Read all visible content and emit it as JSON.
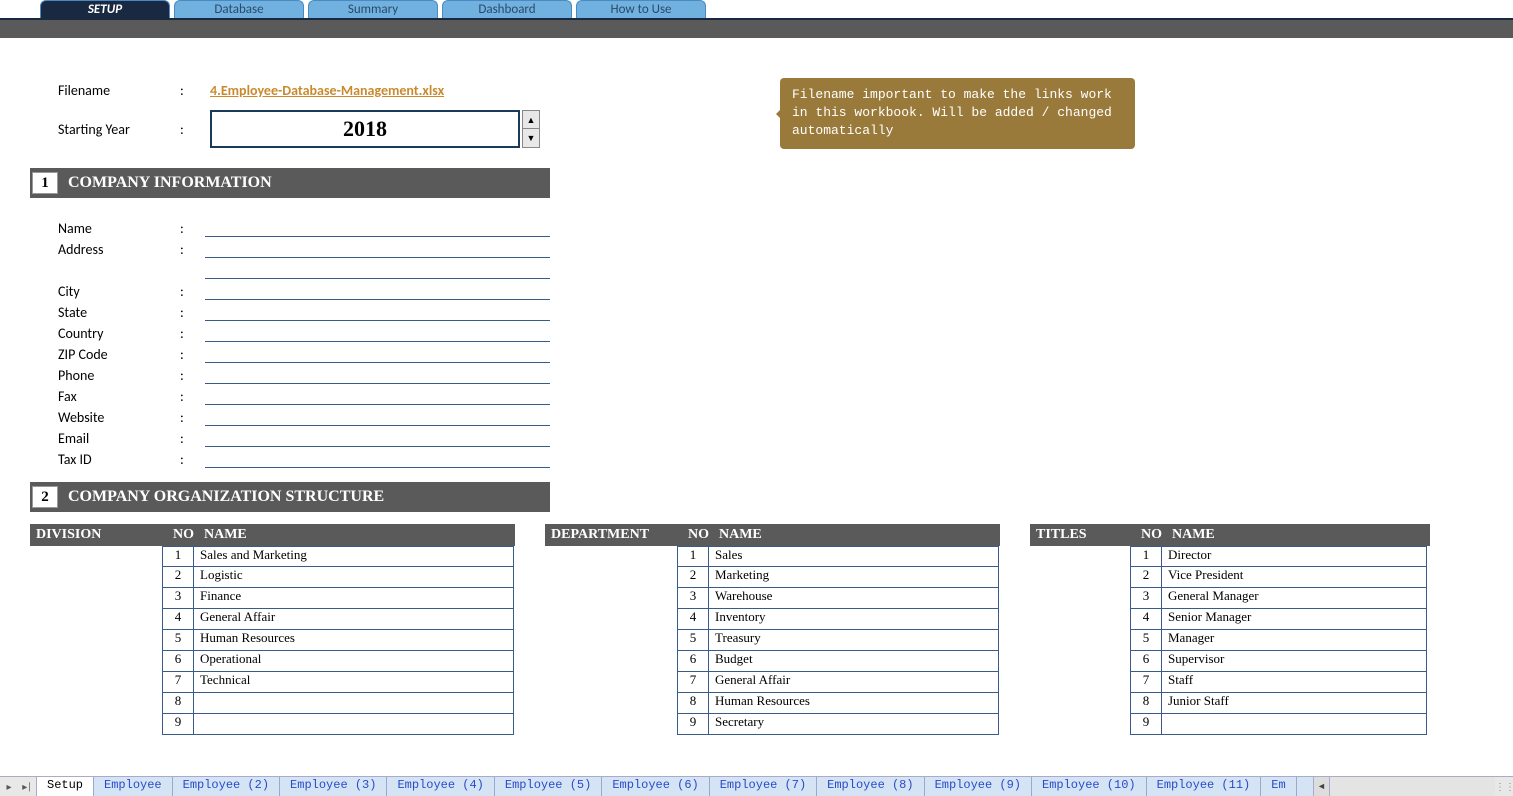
{
  "topTabs": [
    {
      "label": "SETUP",
      "active": true
    },
    {
      "label": "Database",
      "active": false
    },
    {
      "label": "Summary",
      "active": false
    },
    {
      "label": "Dashboard",
      "active": false
    },
    {
      "label": "How to Use",
      "active": false
    }
  ],
  "header": {
    "filenameLabel": "Filename",
    "filenameValue": "4.Employee-Database-Management.xlsx",
    "startingYearLabel": "Starting Year",
    "startingYearValue": "2018",
    "colon": ":"
  },
  "tooltip": "Filename important to make the links work in this workbook. Will be added / changed automatically",
  "section1": {
    "num": "1",
    "title": "COMPANY INFORMATION"
  },
  "section2": {
    "num": "2",
    "title": "COMPANY ORGANIZATION STRUCTURE"
  },
  "companyFields": [
    "Name",
    "Address",
    "",
    "City",
    "State",
    "Country",
    "ZIP Code",
    "Phone",
    "Fax",
    "Website",
    "Email",
    "Tax ID"
  ],
  "tableHeaders": {
    "no": "NO",
    "name": "NAME"
  },
  "division": {
    "title": "DIVISION",
    "rows": [
      {
        "no": "1",
        "name": "Sales and Marketing"
      },
      {
        "no": "2",
        "name": "Logistic"
      },
      {
        "no": "3",
        "name": "Finance"
      },
      {
        "no": "4",
        "name": "General Affair"
      },
      {
        "no": "5",
        "name": "Human Resources"
      },
      {
        "no": "6",
        "name": "Operational"
      },
      {
        "no": "7",
        "name": "Technical"
      },
      {
        "no": "8",
        "name": ""
      },
      {
        "no": "9",
        "name": ""
      }
    ]
  },
  "department": {
    "title": "DEPARTMENT",
    "rows": [
      {
        "no": "1",
        "name": "Sales"
      },
      {
        "no": "2",
        "name": "Marketing"
      },
      {
        "no": "3",
        "name": "Warehouse"
      },
      {
        "no": "4",
        "name": "Inventory"
      },
      {
        "no": "5",
        "name": "Treasury"
      },
      {
        "no": "6",
        "name": "Budget"
      },
      {
        "no": "7",
        "name": "General Affair"
      },
      {
        "no": "8",
        "name": "Human Resources"
      },
      {
        "no": "9",
        "name": "Secretary"
      }
    ]
  },
  "titles": {
    "title": "TITLES",
    "rows": [
      {
        "no": "1",
        "name": "Director"
      },
      {
        "no": "2",
        "name": "Vice President"
      },
      {
        "no": "3",
        "name": "General Manager"
      },
      {
        "no": "4",
        "name": "Senior Manager"
      },
      {
        "no": "5",
        "name": "Manager"
      },
      {
        "no": "6",
        "name": "Supervisor"
      },
      {
        "no": "7",
        "name": "Staff"
      },
      {
        "no": "8",
        "name": "Junior Staff"
      },
      {
        "no": "9",
        "name": ""
      }
    ]
  },
  "sheetTabs": [
    "Setup",
    "Employee",
    "Employee (2)",
    "Employee (3)",
    "Employee (4)",
    "Employee (5)",
    "Employee (6)",
    "Employee (7)",
    "Employee (8)",
    "Employee (9)",
    "Employee (10)",
    "Employee (11)",
    "Em"
  ],
  "activeSheet": "Setup"
}
